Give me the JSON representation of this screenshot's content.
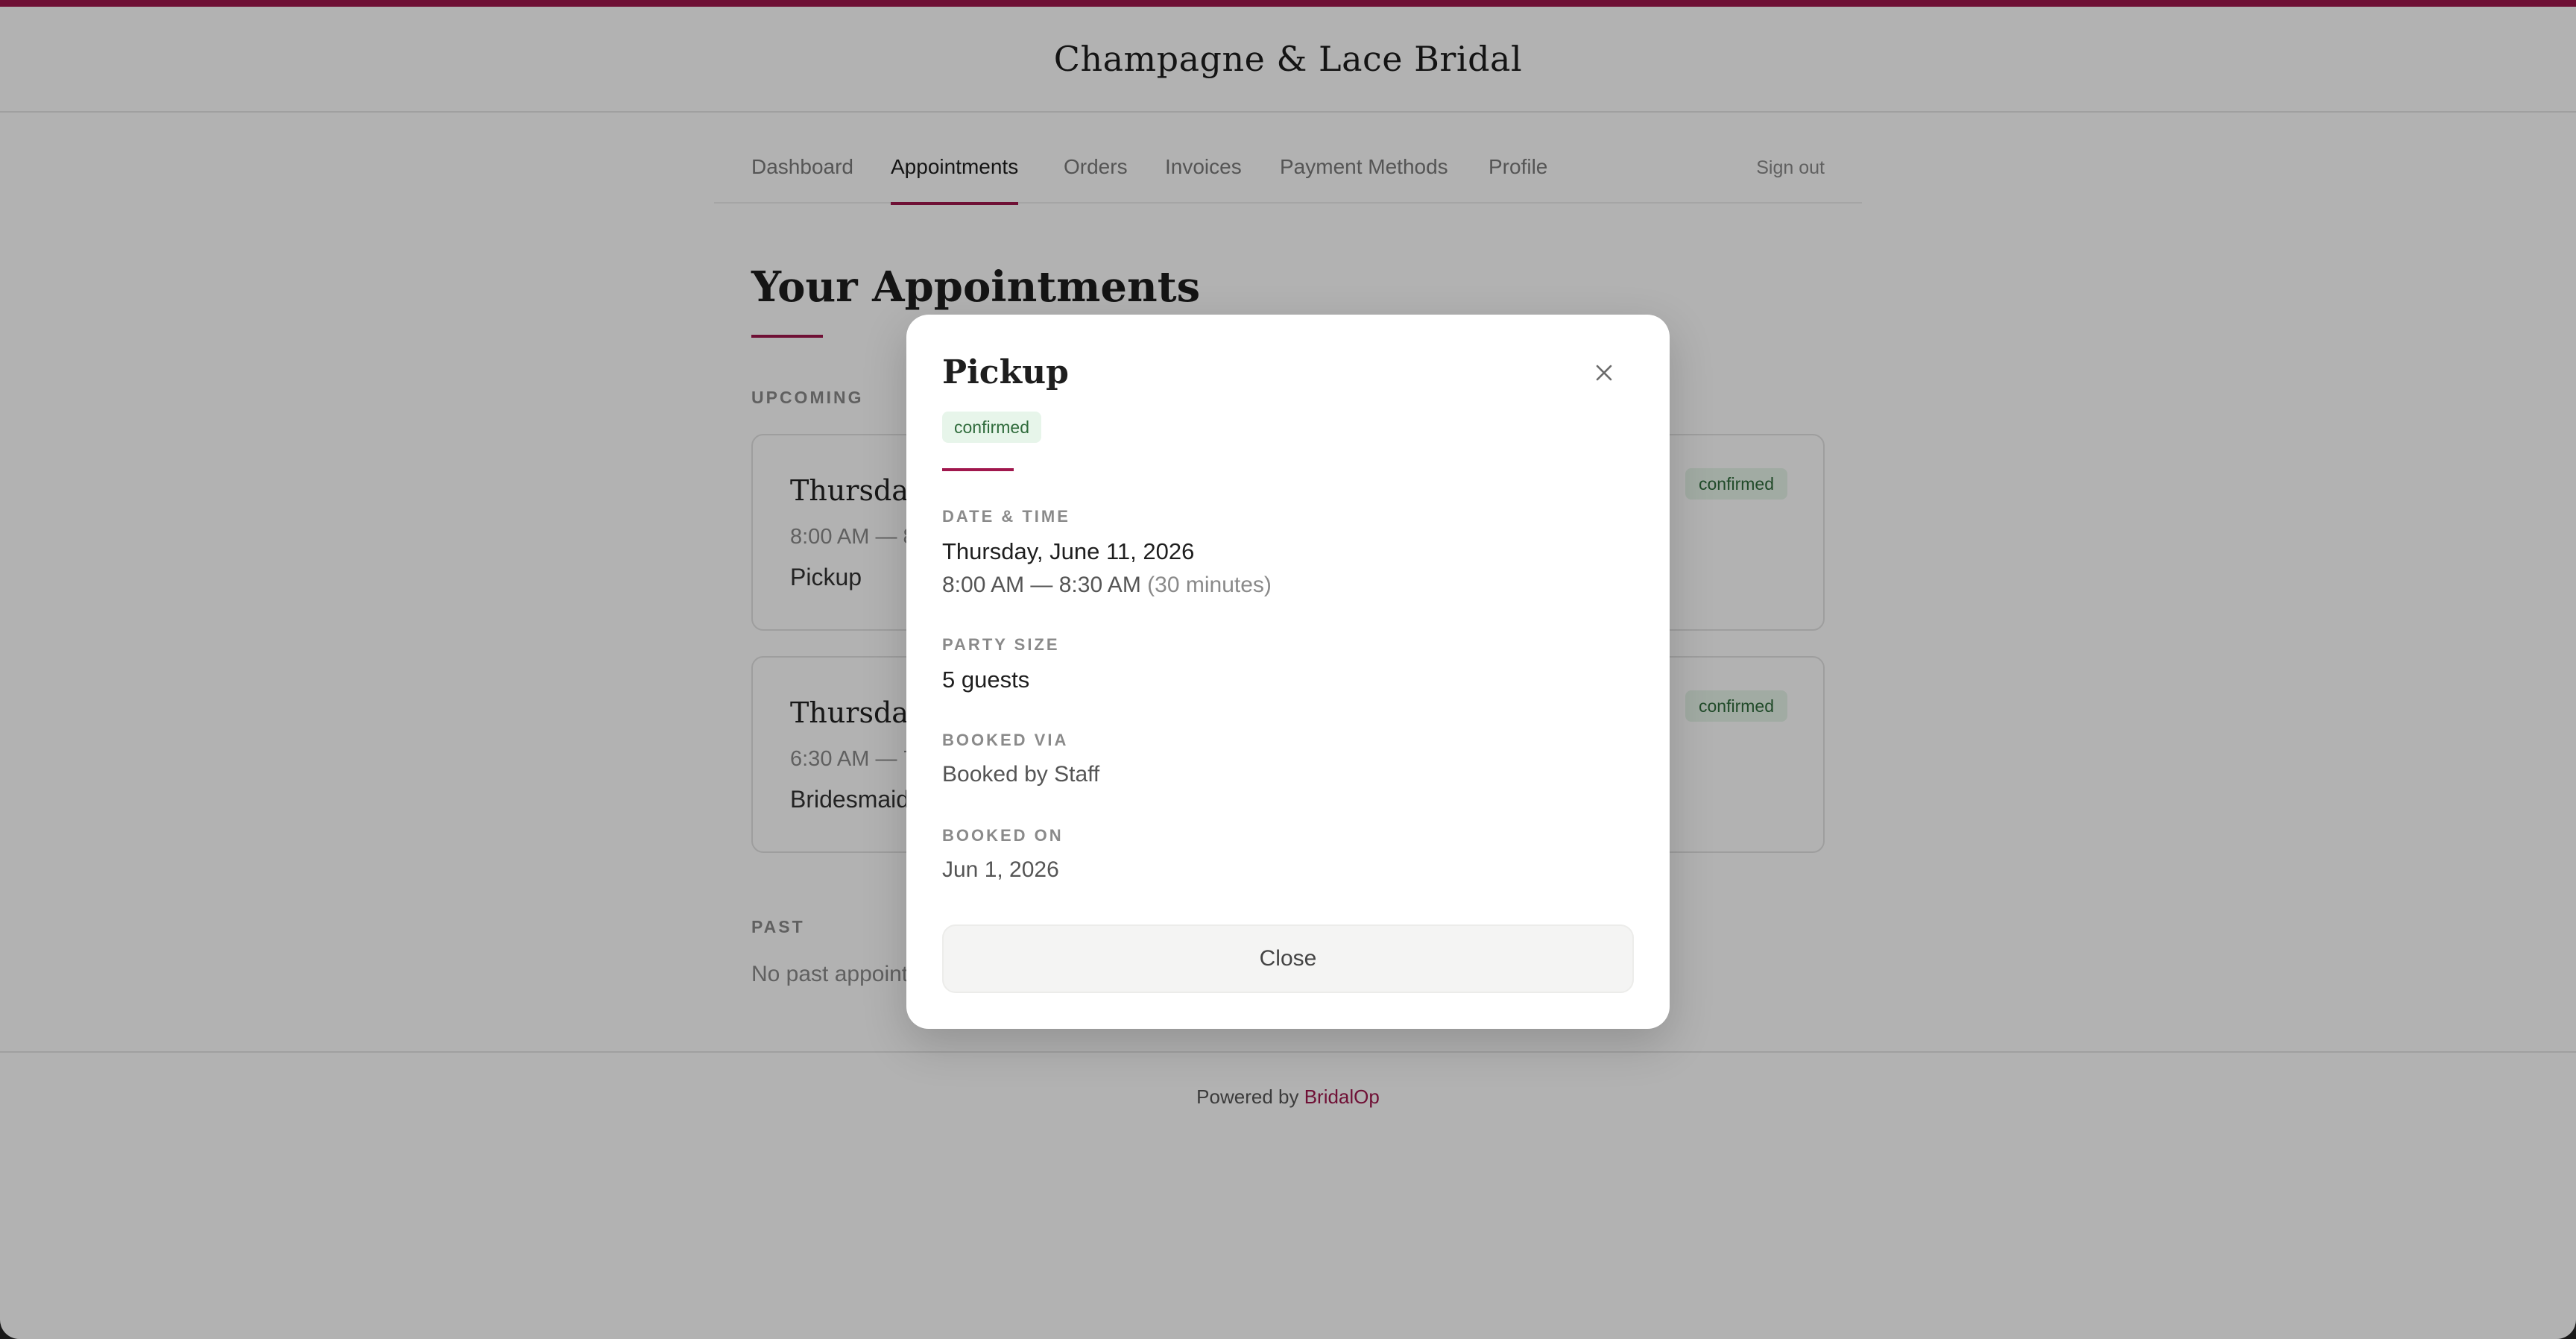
{
  "brand": {
    "name": "Champagne & Lace Bridal",
    "accent": "#a0174d"
  },
  "nav": {
    "tabs": [
      {
        "label": "Dashboard"
      },
      {
        "label": "Appointments",
        "active": true
      },
      {
        "label": "Orders"
      },
      {
        "label": "Invoices"
      },
      {
        "label": "Payment Methods"
      },
      {
        "label": "Profile"
      }
    ],
    "sign_out": "Sign out"
  },
  "page": {
    "title": "Your Appointments",
    "upcoming_label": "UPCOMING",
    "past_label": "PAST",
    "past_empty": "No past appoint"
  },
  "appointments": [
    {
      "date": "Thursday,",
      "time": "8:00 AM — 8",
      "type": "Pickup",
      "status": "confirmed"
    },
    {
      "date": "Thursday,",
      "time": "6:30 AM — 7",
      "type": "Bridesmaid",
      "status": "confirmed"
    }
  ],
  "footer": {
    "prefix": "Powered by ",
    "link": "BridalOp"
  },
  "modal": {
    "title": "Pickup",
    "status": "confirmed",
    "status_color": "#2f6b3b",
    "close_icon": "close-icon",
    "date_time_label": "DATE & TIME",
    "date": "Thursday, June 11, 2026",
    "time_range": "8:00 AM — 8:30 AM",
    "duration": "(30 minutes)",
    "party_size_label": "PARTY SIZE",
    "party_size": "5 guests",
    "booked_via_label": "BOOKED VIA",
    "booked_via": "Booked by Staff",
    "booked_on_label": "BOOKED ON",
    "booked_on": "Jun 1, 2026",
    "close_button": "Close"
  }
}
